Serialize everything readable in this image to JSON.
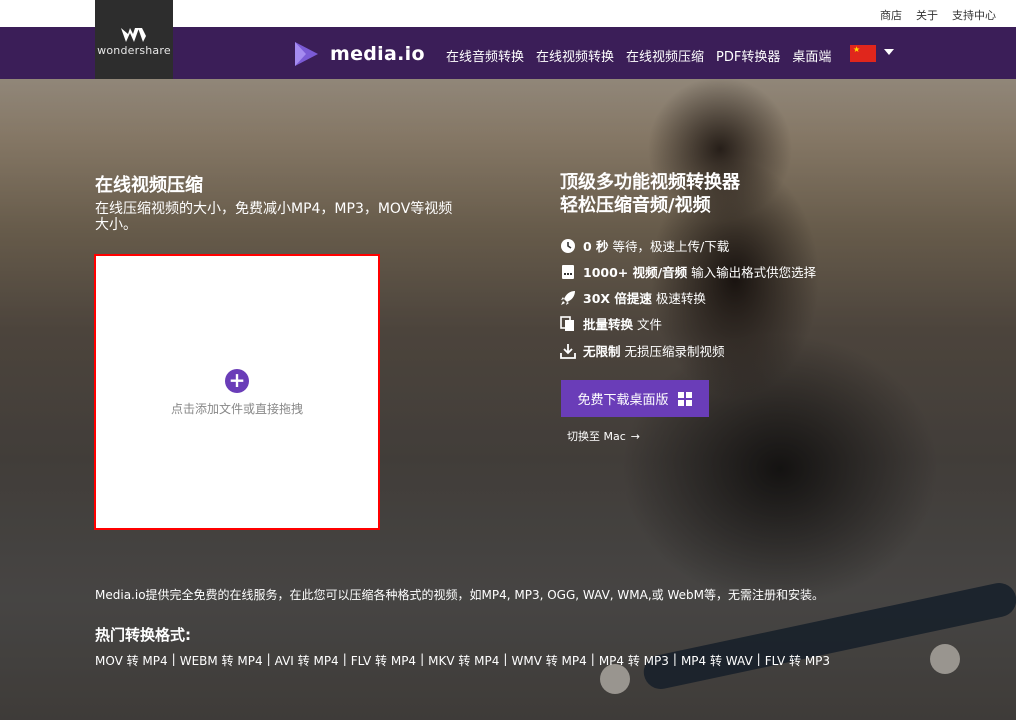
{
  "topbar": {
    "links": [
      "商店",
      "关于",
      "支持中心"
    ]
  },
  "brand": {
    "text": "wondershare"
  },
  "logo": {
    "text": "media.io"
  },
  "menu": [
    "在线音频转换",
    "在线视频转换",
    "在线视频压缩",
    "PDF转换器",
    "桌面端"
  ],
  "left": {
    "title": "在线视频压缩",
    "subtitle": "在线压缩视频的大小，免费减小MP4，MP3，MOV等视频大小。"
  },
  "upload": {
    "text": "点击添加文件或直接拖拽"
  },
  "right": {
    "title_line1": "顶级多功能视频转换器",
    "title_line2": "轻松压缩音频/视频",
    "features": [
      {
        "icon": "clock-icon",
        "bold": "0 秒",
        "text": "等待，极速上传/下载"
      },
      {
        "icon": "file-icon",
        "bold": "1000+ 视频/音频",
        "text": "输入输出格式供您选择"
      },
      {
        "icon": "rocket-icon",
        "bold": "30X 倍提速",
        "text": "极速转换"
      },
      {
        "icon": "copy-icon",
        "bold": "批量转换",
        "text": "文件"
      },
      {
        "icon": "download-icon",
        "bold": "无限制",
        "text": "无损压缩录制视频"
      }
    ],
    "download_button": "免费下载桌面版",
    "mac_link": "切换至 Mac"
  },
  "description": "Media.io提供完全免费的在线服务，在此您可以压缩各种格式的视频，如MP4, MP3, OGG, WAV, WMA,或 WebM等，无需注册和安装。",
  "popular": {
    "title": "热门转换格式:",
    "formats": [
      "MOV 转 MP4",
      "WEBM 转 MP4",
      "AVI 转 MP4",
      "FLV 转 MP4",
      "MKV 转 MP4",
      "WMV 转 MP4",
      "MP4 转 MP3",
      "MP4 转 WAV",
      "FLV 转 MP3"
    ]
  },
  "colors": {
    "nav": "#3b1e58",
    "accent": "#6a3db8",
    "upload_border": "#ff0000"
  }
}
